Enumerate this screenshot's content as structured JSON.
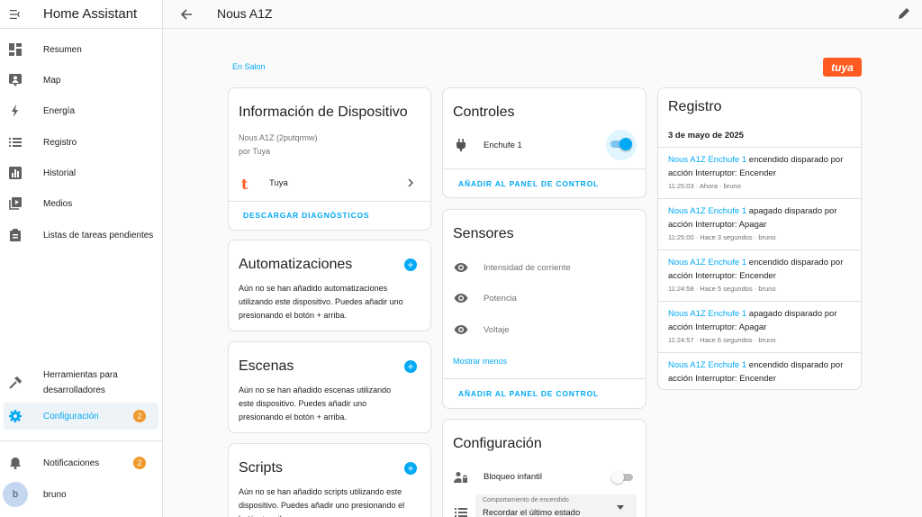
{
  "app": {
    "title": "Home Assistant"
  },
  "sidebar": {
    "items": [
      {
        "label": "Resumen",
        "icon": "dashboard-icon"
      },
      {
        "label": "Map",
        "icon": "map-icon"
      },
      {
        "label": "Energía",
        "icon": "lightning-icon"
      },
      {
        "label": "Registro",
        "icon": "list-icon"
      },
      {
        "label": "Historial",
        "icon": "chart-icon"
      },
      {
        "label": "Medios",
        "icon": "media-icon"
      },
      {
        "label": "Listas de tareas pendientes",
        "icon": "clipboard-icon"
      }
    ],
    "developer_tools": {
      "label_line1": "Herramientas para",
      "label_line2": "desarrolladores"
    },
    "settings": {
      "label": "Configuración",
      "badge": "2"
    },
    "notifications": {
      "label": "Notificaciones",
      "badge": "2"
    },
    "user": {
      "initial": "b",
      "name": "bruno"
    }
  },
  "topbar": {
    "title": "Nous A1Z"
  },
  "area_link": "En Salon",
  "brand_logo_text": "tuya",
  "device_info": {
    "title": "Información de Dispositivo",
    "model": "Nous A1Z (2putqrmw)",
    "manufacturer": "por Tuya",
    "integration": "Tuya",
    "download_button": "DESCARGAR DIAGNÓSTICOS"
  },
  "automations": {
    "title": "Automatizaciones",
    "text": "Aún no se han añadido automatizaciones utilizando este dispositivo. Puedes añadir uno presionando el botón + arriba."
  },
  "scenes": {
    "title": "Escenas",
    "text": "Aún no se han añadido escenas utilizando este dispositivo. Puedes añadir uno presionando el botón + arriba."
  },
  "scripts": {
    "title": "Scripts",
    "text": "Aún no se han añadido scripts utilizando este dispositivo. Puedes añadir uno presionando el botón + arriba."
  },
  "controls": {
    "title": "Controles",
    "entity": "Enchufe 1",
    "state": "on",
    "add_button": "AÑADIR AL PANEL DE CONTROL"
  },
  "sensors": {
    "title": "Sensores",
    "items": [
      "Intensidad de corriente",
      "Potencia",
      "Voltaje"
    ],
    "show_less": "Mostrar menos",
    "add_button": "AÑADIR AL PANEL DE CONTROL"
  },
  "configuration": {
    "title": "Configuración",
    "child_lock": "Bloqueo infantil",
    "child_lock_state": "off",
    "power_on_behavior_label": "Comportamiento de encendido",
    "power_on_behavior_value": "Recordar el último estado"
  },
  "logbook": {
    "title": "Registro",
    "date": "3 de mayo de 2025",
    "entries": [
      {
        "entity": "Nous A1Z Enchufe 1",
        "text": " encendido disparado por acción Interruptor: Encender",
        "meta": "11:25:03 · Ahora · bruno"
      },
      {
        "entity": "Nous A1Z Enchufe 1",
        "text": " apagado disparado por acción Interruptor: Apagar",
        "meta": "11:25:00 · Hace 3 segundos · bruno"
      },
      {
        "entity": "Nous A1Z Enchufe 1",
        "text": " encendido disparado por acción Interruptor: Encender",
        "meta": "11:24:58 · Hace 5 segundos · bruno"
      },
      {
        "entity": "Nous A1Z Enchufe 1",
        "text": " apagado disparado por acción Interruptor: Apagar",
        "meta": "11:24:57 · Hace 6 segundos · bruno"
      },
      {
        "entity": "Nous A1Z Enchufe 1",
        "text": " encendido disparado por acción Interruptor: Encender",
        "meta": ""
      }
    ]
  },
  "colors": {
    "accent": "#03a9f4",
    "badge": "#ef9a2d",
    "tuya": "#ff5a1f"
  }
}
